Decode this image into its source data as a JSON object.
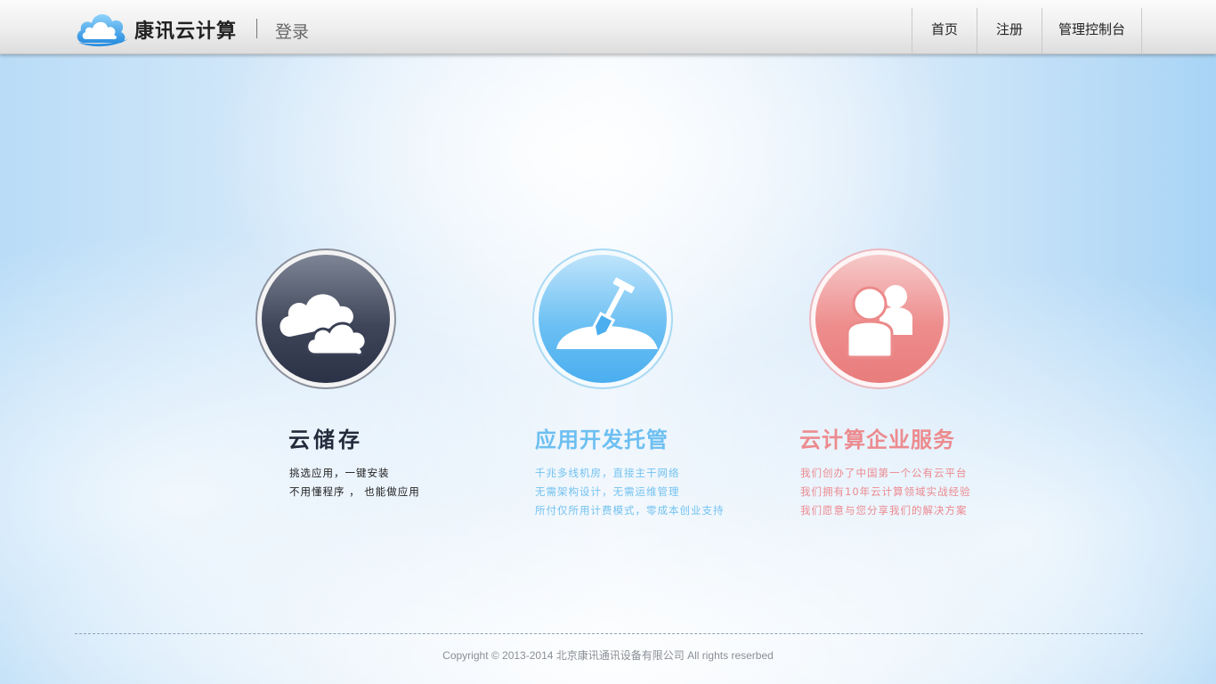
{
  "header": {
    "brand": "康讯云计算",
    "login_label": "登录",
    "logo_icon": "cloud-logo-icon",
    "nav": [
      {
        "label": "首页"
      },
      {
        "label": "注册"
      },
      {
        "label": "管理控制台"
      }
    ]
  },
  "features": [
    {
      "icon": "cloud-storage-icon",
      "title": "云储存",
      "lines": [
        "挑选应用，一键安装",
        "不用懂程序 ， 也能做应用"
      ],
      "color": "#232a3a"
    },
    {
      "icon": "shovel-icon",
      "title": "应用开发托管",
      "lines": [
        "千兆多线机房，直接主干网络",
        "无需架构设计，无需运维管理",
        "所付仅所用计费模式，零成本创业支持"
      ],
      "color": "#6dbff1"
    },
    {
      "icon": "users-icon",
      "title": "云计算企业服务",
      "lines": [
        "我们创办了中国第一个公有云平台",
        "我们拥有10年云计算领域实战经验",
        "我们愿意与您分享我们的解决方案"
      ],
      "color": "#ec8b8f"
    }
  ],
  "footer": {
    "copyright": "Copyright © 2013-2014  北京康讯通讯设备有限公司   All rights reserbed"
  }
}
